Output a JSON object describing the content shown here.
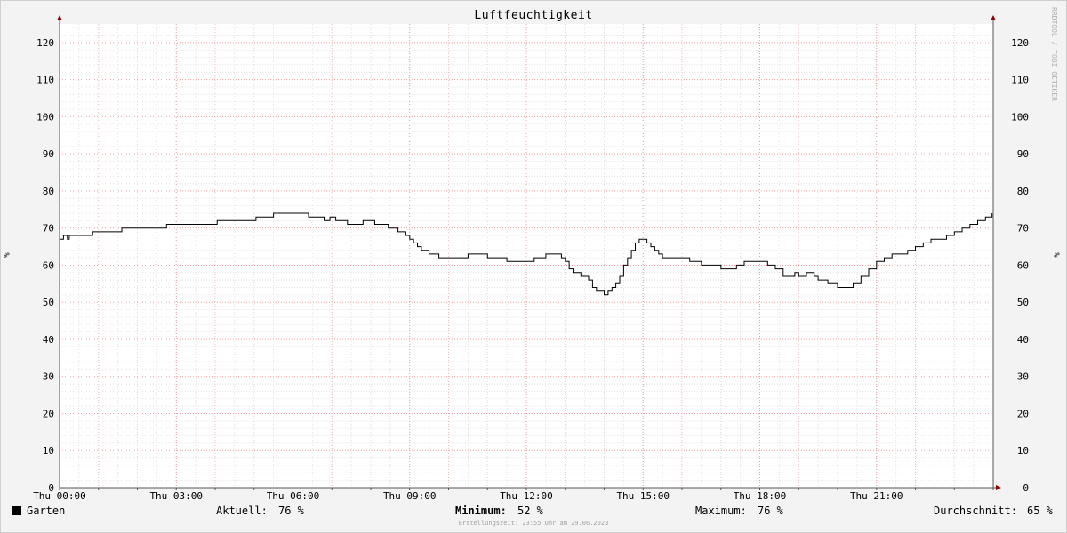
{
  "chart_data": {
    "type": "line",
    "title": "Luftfeuchtigkeit",
    "ylabel": "%",
    "ylim": [
      0,
      125
    ],
    "y_ticks": [
      0,
      10,
      20,
      30,
      40,
      50,
      60,
      70,
      80,
      90,
      100,
      110,
      120
    ],
    "x_hours_range": [
      0,
      24
    ],
    "x_tick_labels": [
      "Thu 00:00",
      "Thu 03:00",
      "Thu 06:00",
      "Thu 09:00",
      "Thu 12:00",
      "Thu 15:00",
      "Thu 18:00",
      "Thu 21:00"
    ],
    "x_tick_hours": [
      0,
      3,
      6,
      9,
      12,
      15,
      18,
      21
    ],
    "grid": true,
    "series": [
      {
        "name": "Garten",
        "color": "#000000",
        "x_hours": [
          0,
          0.1,
          0.2,
          0.25,
          0.35,
          0.8,
          0.85,
          1.5,
          1.6,
          2.7,
          2.75,
          4.0,
          4.05,
          5.0,
          5.05,
          5.4,
          5.5,
          6.0,
          6.05,
          6.4,
          6.5,
          6.55,
          6.8,
          6.85,
          6.95,
          7.1,
          7.2,
          7.3,
          7.4,
          7.55,
          7.6,
          7.8,
          7.9,
          8.0,
          8.1,
          8.2,
          8.35,
          8.45,
          8.6,
          8.7,
          8.8,
          8.9,
          9.0,
          9.1,
          9.2,
          9.3,
          9.5,
          9.6,
          9.75,
          10.0,
          10.2,
          10.5,
          10.75,
          11.0,
          11.2,
          11.5,
          11.75,
          12.0,
          12.2,
          12.5,
          12.8,
          12.9,
          13.0,
          13.1,
          13.2,
          13.4,
          13.6,
          13.7,
          13.8,
          13.9,
          14.0,
          14.1,
          14.2,
          14.3,
          14.4,
          14.5,
          14.6,
          14.7,
          14.8,
          14.9,
          15.0,
          15.1,
          15.2,
          15.3,
          15.4,
          15.5,
          15.75,
          16.0,
          16.2,
          16.5,
          16.75,
          17.0,
          17.2,
          17.4,
          17.6,
          17.75,
          18.0,
          18.2,
          18.4,
          18.6,
          18.8,
          18.9,
          19.0,
          19.1,
          19.2,
          19.3,
          19.4,
          19.5,
          19.6,
          19.75,
          20.0,
          20.2,
          20.4,
          20.6,
          20.8,
          21.0,
          21.2,
          21.4,
          21.6,
          21.8,
          22.0,
          22.2,
          22.4,
          22.6,
          22.8,
          23.0,
          23.2,
          23.4,
          23.6,
          23.8,
          23.97
        ],
        "values": [
          67,
          68,
          67,
          68,
          68,
          68,
          69,
          69,
          70,
          70,
          71,
          71,
          72,
          72,
          73,
          73,
          74,
          74,
          74,
          73,
          73,
          73,
          72,
          72,
          73,
          72,
          72,
          72,
          71,
          71,
          71,
          72,
          72,
          72,
          71,
          71,
          71,
          70,
          70,
          69,
          69,
          68,
          67,
          66,
          65,
          64,
          63,
          63,
          62,
          62,
          62,
          63,
          63,
          62,
          62,
          61,
          61,
          61,
          62,
          63,
          63,
          62,
          61,
          59,
          58,
          57,
          56,
          54,
          53,
          53,
          52,
          53,
          54,
          55,
          57,
          60,
          62,
          64,
          66,
          67,
          67,
          66,
          65,
          64,
          63,
          62,
          62,
          62,
          61,
          60,
          60,
          59,
          59,
          60,
          61,
          61,
          61,
          60,
          59,
          57,
          57,
          58,
          57,
          57,
          58,
          58,
          57,
          56,
          56,
          55,
          54,
          54,
          55,
          57,
          59,
          61,
          62,
          63,
          63,
          64,
          65,
          66,
          67,
          67,
          68,
          69,
          70,
          71,
          72,
          73,
          74,
          75,
          76
        ]
      }
    ]
  },
  "legend": {
    "series_name": "Garten",
    "current_label": "Aktuell:",
    "current_value": "76 %",
    "min_label": "Minimum:",
    "min_value": "52 %",
    "max_label": "Maximum:",
    "max_value": "76 %",
    "avg_label": "Durchschnitt:",
    "avg_value": "65 %"
  },
  "watermark": "RRDTOOL / TOBI OETIKER",
  "footer": "Erstellungszeit: 23:55 Uhr am 29.06.2023"
}
